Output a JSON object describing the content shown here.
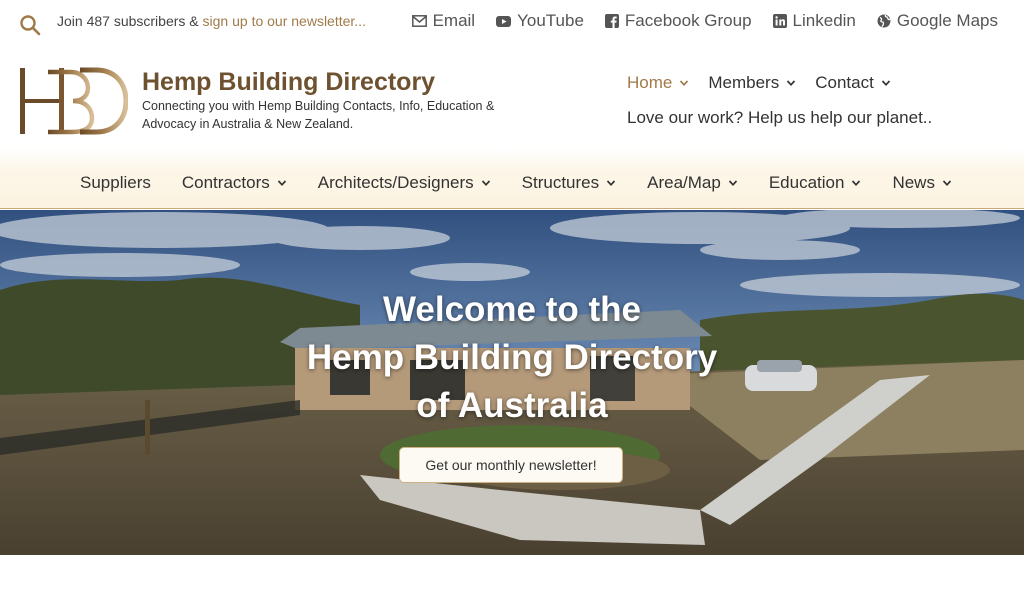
{
  "topbar": {
    "subscribe_prefix": "Join 487 subscribers & ",
    "subscribe_link": "sign up to our newsletter...",
    "social": [
      {
        "label": "Email",
        "icon": "envelope-icon"
      },
      {
        "label": "YouTube",
        "icon": "youtube-icon"
      },
      {
        "label": "Facebook Group",
        "icon": "facebook-icon"
      },
      {
        "label": "Linkedin",
        "icon": "linkedin-icon"
      },
      {
        "label": "Google Maps",
        "icon": "globe-icon"
      }
    ]
  },
  "header": {
    "logo_text": "HBD",
    "title": "Hemp Building Directory",
    "tagline": "Connecting you with Hemp Building Contacts, Info, Education & Advocacy in Australia & New Zealand.",
    "nav": [
      {
        "label": "Home",
        "active": true
      },
      {
        "label": "Members",
        "active": false
      },
      {
        "label": "Contact",
        "active": false
      }
    ],
    "support_text": "Love our work? Help us help our planet.."
  },
  "categories": [
    {
      "label": "Suppliers",
      "dropdown": false
    },
    {
      "label": "Contractors",
      "dropdown": true
    },
    {
      "label": "Architects/Designers",
      "dropdown": true
    },
    {
      "label": "Structures",
      "dropdown": true
    },
    {
      "label": "Area/Map",
      "dropdown": true
    },
    {
      "label": "Education",
      "dropdown": true
    },
    {
      "label": "News",
      "dropdown": true
    }
  ],
  "hero": {
    "title_lines": [
      "Welcome to the",
      "Hemp Building Directory",
      "of Australia"
    ],
    "button_label": "Get our monthly newsletter!"
  },
  "colors": {
    "brand_brown": "#6e5230",
    "accent": "#a07a4a",
    "nav_background": "#fcf3e1"
  }
}
